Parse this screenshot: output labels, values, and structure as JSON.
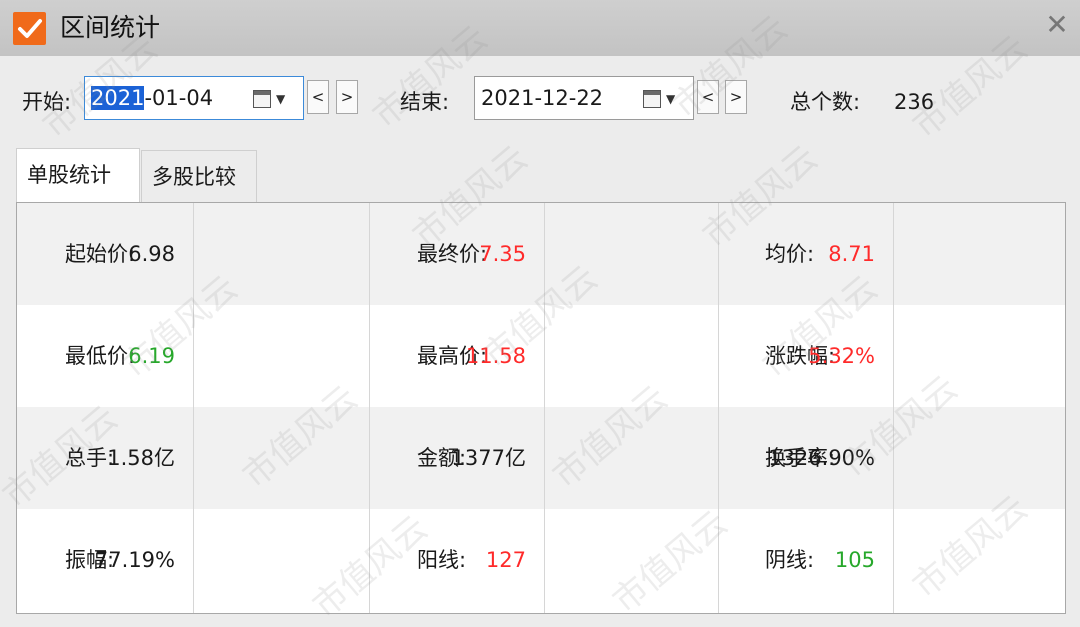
{
  "window": {
    "title": "区间统计",
    "close_glyph": "✕"
  },
  "filters": {
    "start_label": "开始:",
    "start_value_selected": "2021",
    "start_value_rest": "-01-04",
    "end_label": "结束:",
    "end_value": "2021-12-22",
    "prev_glyph": "<",
    "next_glyph": ">",
    "count_label": "总个数:",
    "count_value": "236"
  },
  "tabs": [
    {
      "label": "单股统计",
      "active": true
    },
    {
      "label": "多股比较",
      "active": false
    }
  ],
  "stats": {
    "rows": [
      [
        {
          "label": "起始价:",
          "value": "6.98",
          "color": "neutral"
        },
        {
          "label": "最终价:",
          "value": "7.35",
          "color": "red"
        },
        {
          "label": "均价:",
          "value": "8.71",
          "color": "red"
        }
      ],
      [
        {
          "label": "最低价:",
          "value": "6.19",
          "color": "green"
        },
        {
          "label": "最高价:",
          "value": "11.58",
          "color": "red"
        },
        {
          "label": "涨跌幅:",
          "value": "5.32%",
          "color": "red"
        }
      ],
      [
        {
          "label": "总手:",
          "value": "1.58亿",
          "color": "neutral"
        },
        {
          "label": "金额:",
          "value": "1377亿",
          "color": "neutral"
        },
        {
          "label": "换手率:",
          "value": "1326.90%",
          "color": "neutral"
        }
      ],
      [
        {
          "label": "振幅:",
          "value": "77.19%",
          "color": "neutral"
        },
        {
          "label": "阳线:",
          "value": "127",
          "color": "red"
        },
        {
          "label": "阴线:",
          "value": "105",
          "color": "green"
        }
      ]
    ]
  },
  "watermark": "市值风云",
  "colors": {
    "accent": "#f06a1a",
    "up": "#ff2a2a",
    "down": "#27a82b",
    "selection": "#1b62d6"
  }
}
